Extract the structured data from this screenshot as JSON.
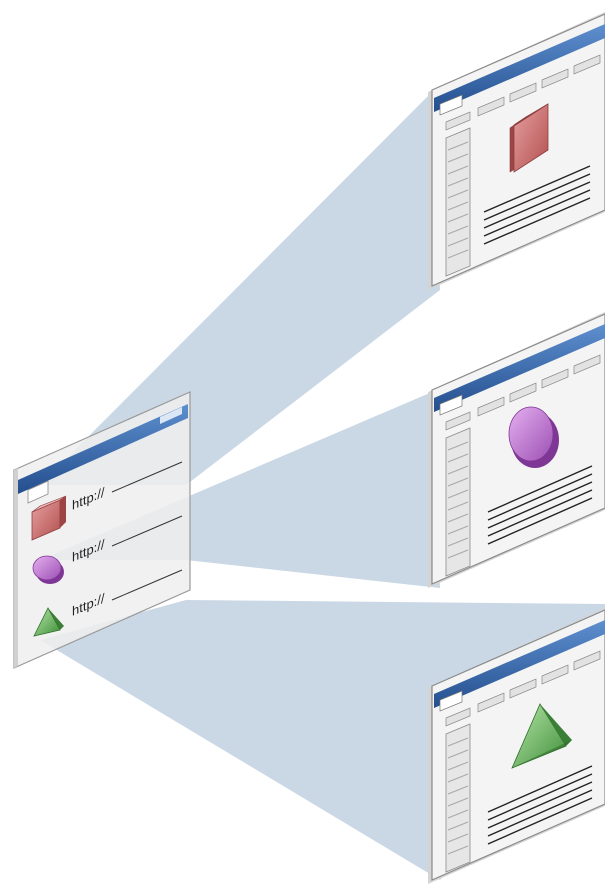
{
  "colors": {
    "beam": "#9fb7cf",
    "window_fill": "#f4f4f4",
    "window_edge": "#8a8a8a",
    "titlebar": "#3a6fb0",
    "cube": "#c86b6b",
    "disc": "#b673c9",
    "pyramid": "#62b05b"
  },
  "source_page": {
    "links": [
      {
        "icon": "cube-icon",
        "text": "http://"
      },
      {
        "icon": "disc-icon",
        "text": "http://"
      },
      {
        "icon": "pyramid-icon",
        "text": "http://"
      }
    ]
  },
  "target_pages": [
    {
      "shape": "cube-icon"
    },
    {
      "shape": "disc-icon"
    },
    {
      "shape": "pyramid-icon"
    }
  ]
}
